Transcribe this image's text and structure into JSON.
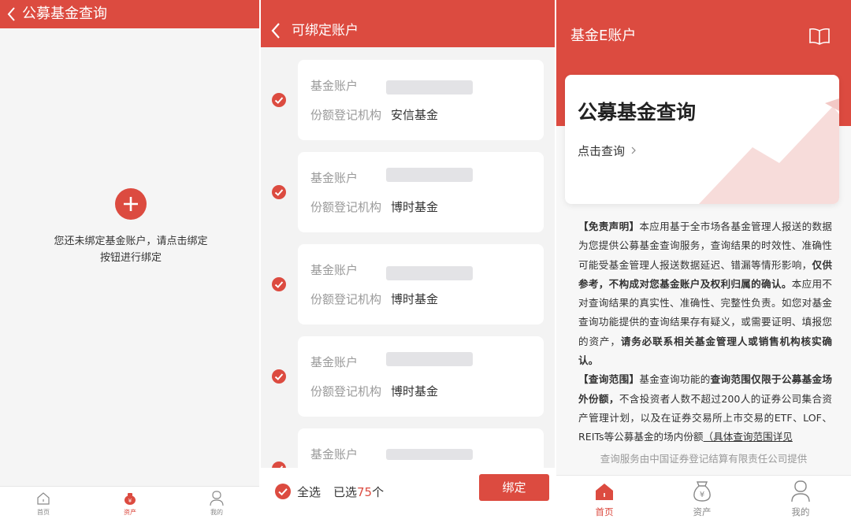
{
  "panel1": {
    "title": "公募基金查询",
    "empty_message": "您还未绑定基金账户，请点击绑定按钮进行绑定",
    "tabs": [
      {
        "label": "首页",
        "active": false
      },
      {
        "label": "资产",
        "active": true
      },
      {
        "label": "我的",
        "active": false
      }
    ]
  },
  "panel2": {
    "title": "可绑定账户",
    "account_label": "基金账户",
    "registrar_label": "份额登记机构",
    "accounts": [
      {
        "registrar": "安信基金",
        "checked": true
      },
      {
        "registrar": "博时基金",
        "checked": true
      },
      {
        "registrar": "博时基金",
        "checked": true
      },
      {
        "registrar": "博时基金",
        "checked": true
      },
      {
        "registrar": "",
        "checked": true
      }
    ],
    "select_all": "全选",
    "selected_prefix": "已选",
    "selected_count": "75",
    "selected_suffix": "个",
    "bind_button": "绑定"
  },
  "panel3": {
    "title": "基金E账户",
    "card_title": "公募基金查询",
    "card_link": "点击查询",
    "disclaimer": {
      "s1": "【免责声明】",
      "s2": "本应用基于全市场各基金管理人报送的数据为您提供公募基金查询服务，查询结果的时效性、准确性可能受基金管理人报送数据延迟、错漏等情形影响，",
      "s3": "仅供参考，不构成对您基金账户及权利归属的确认。",
      "s4": "本应用不对查询结果的真实性、准确性、完整性负责。如您对基金查询功能提供的查询结果存有疑义，或需要证明、填报您的资产，",
      "s5": "请务必联系相关基金管理人或销售机构核实确认。",
      "s6": "【查询范围】",
      "s7": "基金查询功能的",
      "s8": "查询范围仅限于公募基金场外份额，",
      "s9": "不含投资者人数不超过200人的证券公司集合资产管理计划，以及在证券交易所上市交易的ETF、LOF、REITs等公募基金的场内份额",
      "s10": "（具体查询范围详见"
    },
    "footer_note": "查询服务由中国证券登记结算有限责任公司提供",
    "tabs": [
      {
        "label": "首页",
        "active": true
      },
      {
        "label": "资产",
        "active": false
      },
      {
        "label": "我的",
        "active": false
      }
    ]
  },
  "colors": {
    "accent": "#dc4b40"
  }
}
